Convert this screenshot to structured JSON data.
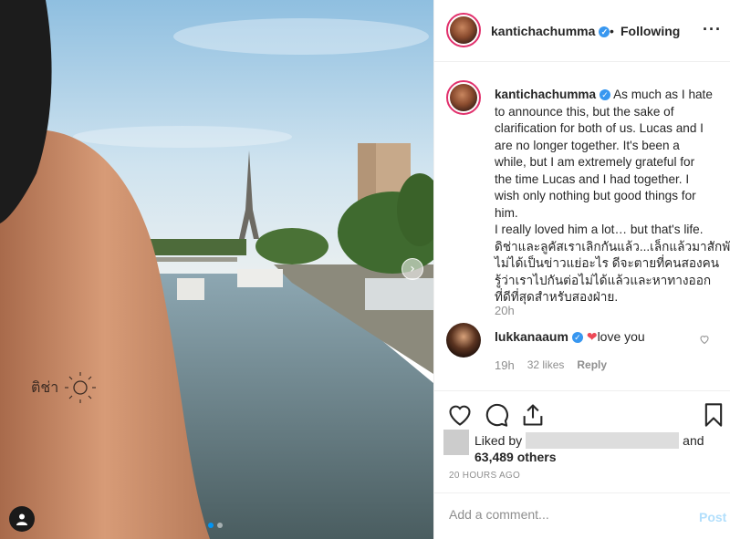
{
  "post": {
    "username": "kantichachumma",
    "follow_status": "Following",
    "separator": "•",
    "more_icon": "more-horizontal-icon",
    "caption_lines": [
      "As much as I hate",
      "to announce this, but the sake of",
      "clarification for both of us. Lucas and I",
      "are no longer together. It's been a",
      "while, but I am extremely grateful for",
      "the time Lucas and I had together. I",
      "wish only nothing but good things for",
      "him.",
      "I really loved him a lot… but that's life.",
      "ดิช่าและลูคัสเราเลิกกันแล้ว...เล็กแล้วมาสักพัก.",
      "ไม่ได้เป็นข่าวแย่อะไร ดีจะตายที่คนสองคน",
      "รู้ว่าเราไปกันต่อไม่ได้แล้วและหาทางออก",
      "ที่ดีที่สุดสำหรับสองฝ่าย."
    ],
    "caption_time": "20h"
  },
  "comment": {
    "username": "lukkanaaum",
    "text": "love you",
    "heart": "❤",
    "time": "19h",
    "likes": "32 likes",
    "reply": "Reply"
  },
  "likes": {
    "liked_by": "Liked by",
    "and": "and",
    "count": "63,489 others"
  },
  "timestamp": "20 HOURS AGO",
  "add_comment": {
    "placeholder": "Add a comment...",
    "post_label": "Post"
  },
  "colors": {
    "verified": "#3897f0",
    "link_disabled": "#b2dffc",
    "heart": "#ed4956",
    "carousel_active": "#0095f6"
  },
  "photo": {
    "tattoo_text": "ติช่า",
    "carousel_index": 1,
    "carousel_total": 2
  }
}
